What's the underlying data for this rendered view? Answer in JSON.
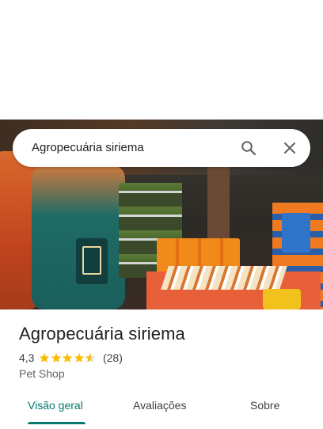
{
  "search": {
    "query": "Agropecuária siriema"
  },
  "place": {
    "title": "Agropecuária siriema",
    "rating": "4,3",
    "stars": 4.3,
    "review_count": "(28)",
    "category": "Pet Shop"
  },
  "tabs": [
    {
      "label": "Visão geral",
      "active": true
    },
    {
      "label": "Avaliações",
      "active": false
    },
    {
      "label": "Sobre",
      "active": false
    }
  ],
  "colors": {
    "accent": "#00796b",
    "star": "#fbbc04"
  },
  "icons": {
    "search": "search-icon",
    "close": "close-icon"
  }
}
